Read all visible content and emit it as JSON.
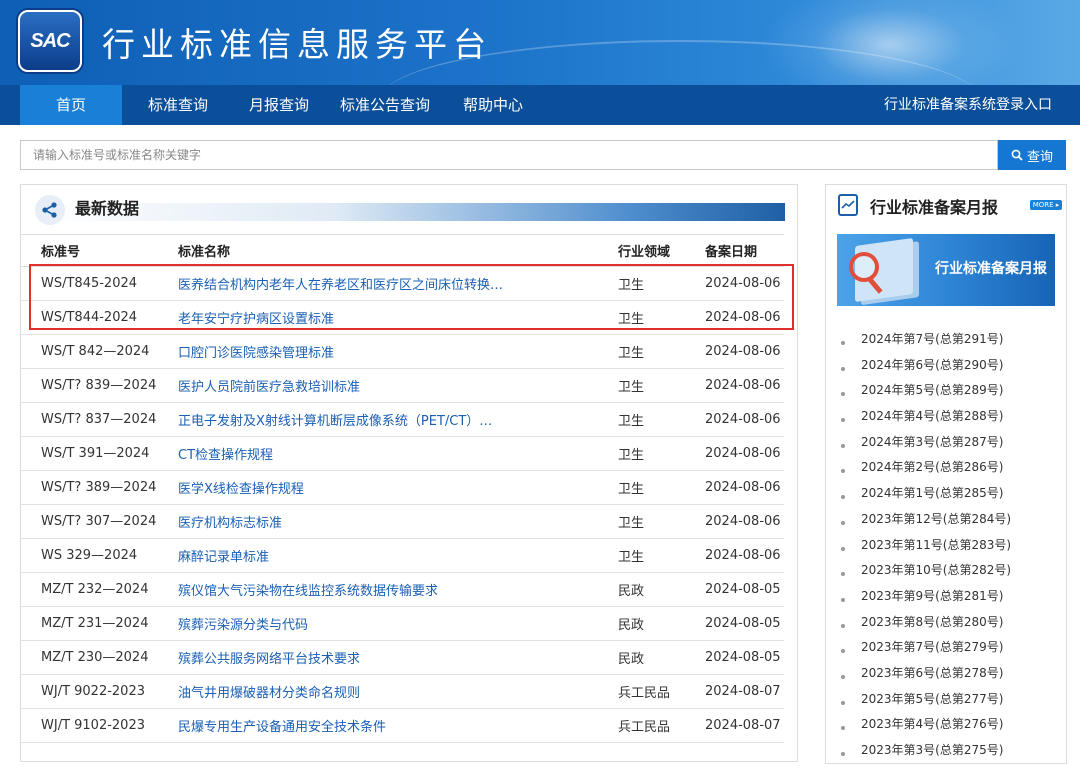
{
  "header": {
    "logo_text": "SAC",
    "site_title": "行业标准信息服务平台"
  },
  "nav": {
    "items": [
      "首页",
      "标准查询",
      "月报查询",
      "标准公告查询",
      "帮助中心"
    ],
    "active_index": 0,
    "right_link": "行业标准备案系统登录入口"
  },
  "search": {
    "placeholder": "请输入标准号或标准名称关键字",
    "button_label": "查询",
    "button_icon": "search-icon"
  },
  "latest": {
    "title": "最新数据",
    "icon": "share-icon",
    "columns": [
      "标准号",
      "标准名称",
      "行业领域",
      "备案日期"
    ],
    "rows": [
      {
        "code": "WS/T845-2024",
        "name": "医养结合机构内老年人在养老区和医疗区之间床位转换…",
        "field": "卫生",
        "date": "2024-08-06"
      },
      {
        "code": "WS/T844-2024",
        "name": "老年安宁疗护病区设置标准",
        "field": "卫生",
        "date": "2024-08-06"
      },
      {
        "code": "WS/T 842—2024",
        "name": "口腔门诊医院感染管理标准",
        "field": "卫生",
        "date": "2024-08-06"
      },
      {
        "code": "WS/T? 839—2024",
        "name": "医护人员院前医疗急救培训标准",
        "field": "卫生",
        "date": "2024-08-06"
      },
      {
        "code": "WS/T? 837—2024",
        "name": "正电子发射及X射线计算机断层成像系统（PET/CT）…",
        "field": "卫生",
        "date": "2024-08-06"
      },
      {
        "code": "WS/T 391—2024",
        "name": "CT检查操作规程",
        "field": "卫生",
        "date": "2024-08-06"
      },
      {
        "code": "WS/T? 389—2024",
        "name": "医学X线检查操作规程",
        "field": "卫生",
        "date": "2024-08-06"
      },
      {
        "code": "WS/T? 307—2024",
        "name": "医疗机构标志标准",
        "field": "卫生",
        "date": "2024-08-06"
      },
      {
        "code": "WS 329—2024",
        "name": "麻醉记录单标准",
        "field": "卫生",
        "date": "2024-08-06"
      },
      {
        "code": "MZ/T 232—2024",
        "name": "殡仪馆大气污染物在线监控系统数据传输要求",
        "field": "民政",
        "date": "2024-08-05"
      },
      {
        "code": "MZ/T 231—2024",
        "name": "殡葬污染源分类与代码",
        "field": "民政",
        "date": "2024-08-05"
      },
      {
        "code": "MZ/T 230—2024",
        "name": "殡葬公共服务网络平台技术要求",
        "field": "民政",
        "date": "2024-08-05"
      },
      {
        "code": "WJ/T 9022-2023",
        "name": "油气井用爆破器材分类命名规则",
        "field": "兵工民品",
        "date": "2024-08-07"
      },
      {
        "code": "WJ/T 9102-2023",
        "name": "民爆专用生产设备通用安全技术条件",
        "field": "兵工民品",
        "date": "2024-08-07"
      }
    ]
  },
  "monthly": {
    "title": "行业标准备案月报",
    "more_label": "MORE ▸",
    "banner_label": "行业标准备案月报",
    "items": [
      "2024年第7号(总第291号)",
      "2024年第6号(总第290号)",
      "2024年第5号(总第289号)",
      "2024年第4号(总第288号)",
      "2024年第3号(总第287号)",
      "2024年第2号(总第286号)",
      "2024年第1号(总第285号)",
      "2023年第12号(总第284号)",
      "2023年第11号(总第283号)",
      "2023年第10号(总第282号)",
      "2023年第9号(总第281号)",
      "2023年第8号(总第280号)",
      "2023年第7号(总第279号)",
      "2023年第6号(总第278号)",
      "2023年第5号(总第277号)",
      "2023年第4号(总第276号)",
      "2023年第3号(总第275号)"
    ]
  }
}
